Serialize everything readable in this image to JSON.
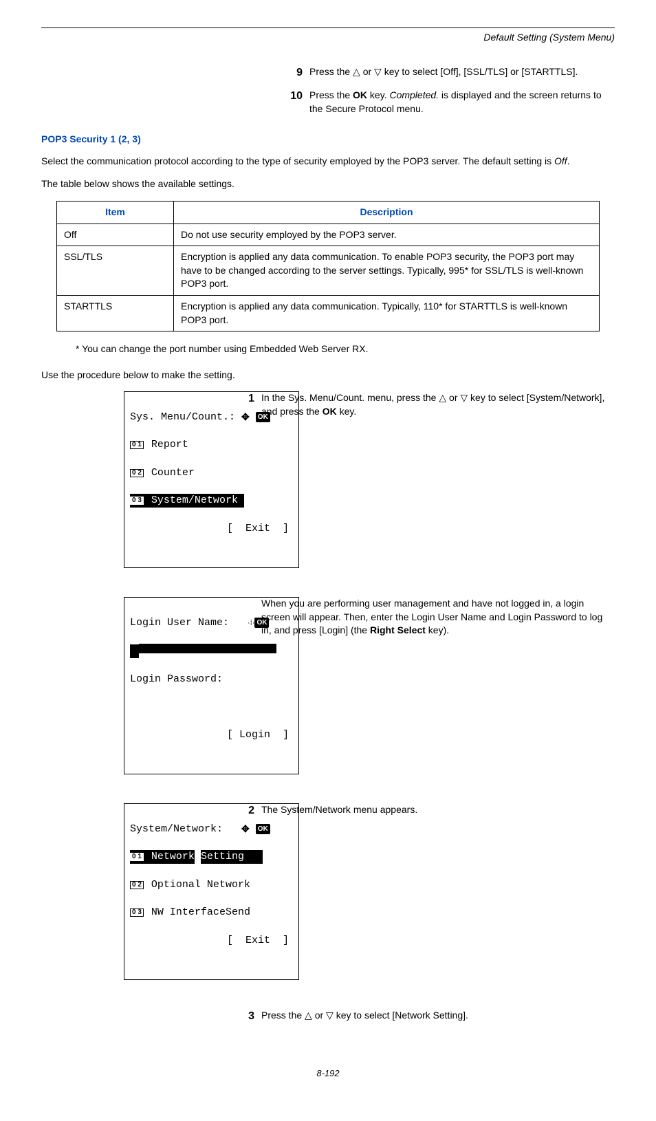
{
  "header": {
    "section_title": "Default Setting (System Menu)"
  },
  "top_steps": {
    "s9": {
      "num": "9",
      "text_a": "Press the ",
      "text_b": " or ",
      "text_c": " key to select [Off], [SSL/TLS] or [STARTTLS]."
    },
    "s10": {
      "num": "10",
      "text_a": "Press the ",
      "ok": "OK",
      "text_b": " key. ",
      "completed": "Completed.",
      "text_c": " is displayed and the screen returns to the Secure Protocol menu."
    }
  },
  "section": {
    "heading": "POP3 Security 1 (2, 3)",
    "para1": "Select the communication protocol according to the type of security employed by the POP3 server. The default setting is ",
    "para1_off": "Off",
    "para1_end": ".",
    "para2": "The table below shows the available settings."
  },
  "table": {
    "head_item": "Item",
    "head_desc": "Description",
    "rows": [
      {
        "item": "Off",
        "desc": "Do not use security employed by the POP3 server."
      },
      {
        "item": "SSL/TLS",
        "desc": "Encryption is applied any data communication. To enable POP3 security, the POP3 port may have to be changed according to the server settings. Typically, 995* for SSL/TLS is well-known POP3 port."
      },
      {
        "item": "STARTTLS",
        "desc": "Encryption is applied any data communication. Typically, 110* for STARTTLS is well-known POP3 port."
      }
    ]
  },
  "footnote": "* You can change the port number using Embedded Web Server RX.",
  "proc_intro": "Use the procedure below to make the setting.",
  "lcd1": {
    "title": "Sys. Menu/Count.:",
    "l1_num": "0 1",
    "l1": "Report",
    "l2_num": "0 2",
    "l2": "Counter",
    "l3_num": "0 3",
    "l3": "System/Network",
    "exit": "[  Exit  ]"
  },
  "lcd2": {
    "l1": "Login User Name:",
    "l3": "Login Password:",
    "login": "[ Login  ]"
  },
  "lcd3": {
    "title": "System/Network:",
    "l1_num": "0 1",
    "l1_a": "Network",
    "l1_b": "Setting",
    "l2_num": "0 2",
    "l2": "Optional Network",
    "l3_num": "0 3",
    "l3": "NW InterfaceSend",
    "exit": "[  Exit  ]"
  },
  "right_steps": {
    "s1": {
      "num": "1",
      "a": "In the Sys. Menu/Count. menu, press the ",
      "b": " or ",
      "c": " key to select [System/Network], and press the ",
      "ok": "OK",
      "d": " key."
    },
    "note": {
      "a": "When you are performing user management and have not logged in, a login screen will appear. Then, enter the Login User Name and Login Password to log in, and press [Login] (the ",
      "b": "Right Select",
      "c": " key)."
    },
    "s2": {
      "num": "2",
      "text": "The System/Network menu appears."
    },
    "s3": {
      "num": "3",
      "a": "Press the ",
      "b": " or ",
      "c": " key to select [Network Setting]."
    }
  },
  "page_number": "8-192"
}
